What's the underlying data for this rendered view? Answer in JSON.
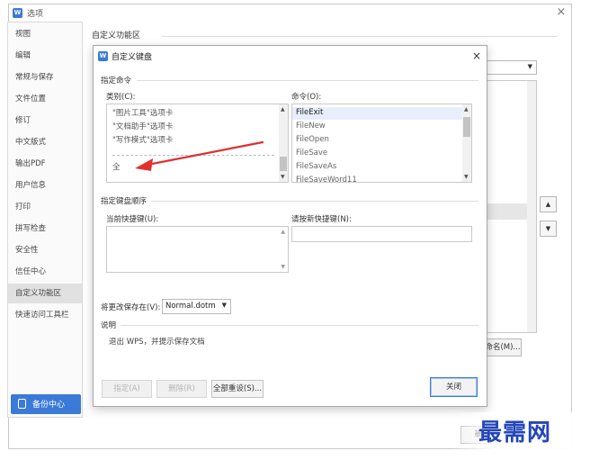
{
  "outer_window": {
    "title": "选项",
    "app_icon": "wps-writer-icon",
    "close_label": "×"
  },
  "sidebar": {
    "items": [
      {
        "label": "视图"
      },
      {
        "label": "编辑"
      },
      {
        "label": "常规与保存"
      },
      {
        "label": "文件位置"
      },
      {
        "label": "修订"
      },
      {
        "label": "中文版式"
      },
      {
        "label": "输出PDF"
      },
      {
        "label": "用户信息"
      },
      {
        "label": "打印"
      },
      {
        "label": "拼写检查"
      },
      {
        "label": "安全性"
      },
      {
        "label": "信任中心"
      },
      {
        "label": "自定义功能区",
        "selected": true
      },
      {
        "label": "快速访问工具栏"
      }
    ],
    "backup_button": "备份中心"
  },
  "behind_panel": {
    "heading": "自定义功能区",
    "rename_button": "命名(M)...",
    "ok_button": "确"
  },
  "dialog": {
    "title": "自定义键盘",
    "close_label": "×",
    "specify_command_heading": "指定命令",
    "categories_label": "类别(C):",
    "categories": [
      "\"图片工具\"选项卡",
      "\"文档助手\"选项卡",
      "\"写作模式\"选项卡",
      "",
      "全"
    ],
    "commands_label": "命令(O):",
    "commands": [
      "FileExit",
      "FileNew",
      "FileOpen",
      "FileSave",
      "FileSaveAs",
      "FileSaveWord11"
    ],
    "selected_command": "FileExit",
    "specify_key_sequence_heading": "指定键盘顺序",
    "current_keys_label": "当前快捷键(U):",
    "new_key_label": "请按新快捷键(N):",
    "new_key_value": "",
    "save_changes_label": "将更改保存在(V):",
    "save_changes_value": "Normal.dotm",
    "description_heading": "说明",
    "description_text": "退出 WPS，并提示保存文档",
    "buttons": {
      "assign": "指定(A)",
      "remove": "删除(R)",
      "reset_all": "全部重设(S)...",
      "close": "关闭"
    }
  },
  "annotation": {
    "arrow_color": "#e03030"
  },
  "watermark": "最需网",
  "colors": {
    "accent": "#3a79d8",
    "watermark": "#2446b8"
  }
}
